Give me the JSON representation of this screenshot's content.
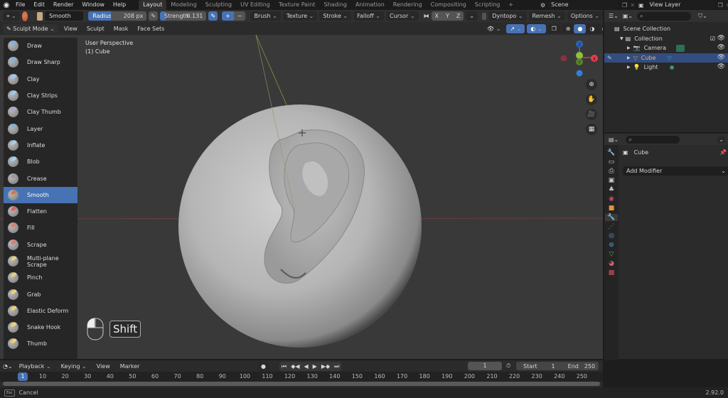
{
  "menu": {
    "items": [
      "File",
      "Edit",
      "Render",
      "Window",
      "Help"
    ],
    "workspaces": [
      "Layout",
      "Modeling",
      "Sculpting",
      "UV Editing",
      "Texture Paint",
      "Shading",
      "Animation",
      "Rendering",
      "Compositing",
      "Scripting"
    ],
    "active_workspace": "Layout",
    "add_tab": "+",
    "scene": "Scene",
    "view_layer": "View Layer"
  },
  "toolheader": {
    "brush_name": "Smooth",
    "radius_label": "Radius",
    "radius_value": "208 px",
    "strength_label": "Strength",
    "strength_value": "0.131",
    "plus": "+",
    "minus": "−",
    "menus": [
      "Brush",
      "Texture",
      "Stroke",
      "Falloff",
      "Cursor"
    ],
    "axes": [
      "X",
      "Y",
      "Z"
    ],
    "dyntopo": "Dyntopo",
    "remesh": "Remesh",
    "options": "Options"
  },
  "modeheader": {
    "mode": "Sculpt Mode",
    "menus": [
      "View",
      "Sculpt",
      "Mask",
      "Face Sets"
    ]
  },
  "viewport": {
    "perspective": "User Perspective",
    "object": "(1) Cube",
    "key_hint": "Shift",
    "gizmo": {
      "x": "X",
      "y": "Y",
      "z": "Z"
    }
  },
  "tools": [
    {
      "label": "Draw",
      "color": "#7fb3e0"
    },
    {
      "label": "Draw Sharp",
      "color": "#7fb3e0"
    },
    {
      "label": "Clay",
      "color": "#9fc8ee"
    },
    {
      "label": "Clay Strips",
      "color": "#9fc8ee"
    },
    {
      "label": "Clay Thumb",
      "color": "#aac"
    },
    {
      "label": "Layer",
      "color": "#7fb3e0"
    },
    {
      "label": "Inflate",
      "color": "#9fd0f0"
    },
    {
      "label": "Blob",
      "color": "#9fd0f0"
    },
    {
      "label": "Crease",
      "color": "#999"
    },
    {
      "label": "Smooth",
      "color": "#e0704a",
      "active": true
    },
    {
      "label": "Flatten",
      "color": "#e06060"
    },
    {
      "label": "Fill",
      "color": "#d88070"
    },
    {
      "label": "Scrape",
      "color": "#d88070"
    },
    {
      "label": "Multi-plane Scrape",
      "color": "#e8d070"
    },
    {
      "label": "Pinch",
      "color": "#e8d070"
    },
    {
      "label": "Grab",
      "color": "#f0d070"
    },
    {
      "label": "Elastic Deform",
      "color": "#f0d070"
    },
    {
      "label": "Snake Hook",
      "color": "#f0d070"
    },
    {
      "label": "Thumb",
      "color": "#f0d070"
    }
  ],
  "outliner": {
    "root": "Scene Collection",
    "collection": "Collection",
    "items": [
      {
        "label": "Camera",
        "icon": "camera-icon",
        "selected": false
      },
      {
        "label": "Cube",
        "icon": "mesh-icon",
        "selected": true
      },
      {
        "label": "Light",
        "icon": "light-icon",
        "selected": false
      }
    ]
  },
  "properties": {
    "object_name": "Cube",
    "add_modifier": "Add Modifier"
  },
  "timeline": {
    "menus": [
      "Playback",
      "Keying",
      "View",
      "Marker"
    ],
    "current_frame": "1",
    "start_label": "Start",
    "start": "1",
    "end_label": "End",
    "end": "250",
    "ticks": [
      "10",
      "20",
      "30",
      "40",
      "50",
      "60",
      "70",
      "80",
      "90",
      "100",
      "110",
      "120",
      "130",
      "140",
      "150",
      "160",
      "170",
      "180",
      "190",
      "200",
      "210",
      "220",
      "230",
      "240",
      "250"
    ],
    "playhead": "1"
  },
  "status": {
    "key": "Esc",
    "action": "Cancel",
    "version": "2.92.0"
  }
}
